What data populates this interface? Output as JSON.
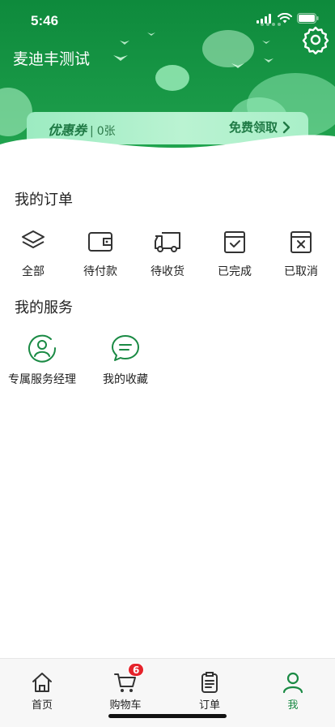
{
  "status_bar": {
    "time": "5:46"
  },
  "header": {
    "user_name": "麦迪丰测试",
    "colors": {
      "primary": "#0e8a3c",
      "coupon_bg": "#aeefcb",
      "accent_text": "#1f7a45"
    }
  },
  "coupon": {
    "title": "优惠券",
    "separator": "|",
    "count": "0张",
    "claim_label": "免费领取"
  },
  "orders": {
    "title": "我的订单",
    "items": [
      {
        "label": "全部",
        "icon": "layers-icon"
      },
      {
        "label": "待付款",
        "icon": "wallet-icon"
      },
      {
        "label": "待收货",
        "icon": "truck-icon"
      },
      {
        "label": "已完成",
        "icon": "calendar-check-icon"
      },
      {
        "label": "已取消",
        "icon": "calendar-x-icon"
      }
    ]
  },
  "services": {
    "title": "我的服务",
    "items": [
      {
        "label": "专属服务经理",
        "icon": "service-manager-icon"
      },
      {
        "label": "我的收藏",
        "icon": "chat-bubble-icon"
      }
    ]
  },
  "tabbar": {
    "items": [
      {
        "label": "首页",
        "icon": "home-icon"
      },
      {
        "label": "购物车",
        "icon": "cart-icon"
      },
      {
        "label": "订单",
        "icon": "clipboard-icon"
      },
      {
        "label": "我",
        "icon": "person-icon"
      }
    ],
    "active_index": 3,
    "cart_badge": "6",
    "active_color": "#1a8a44",
    "badge_color": "#e5232b"
  }
}
